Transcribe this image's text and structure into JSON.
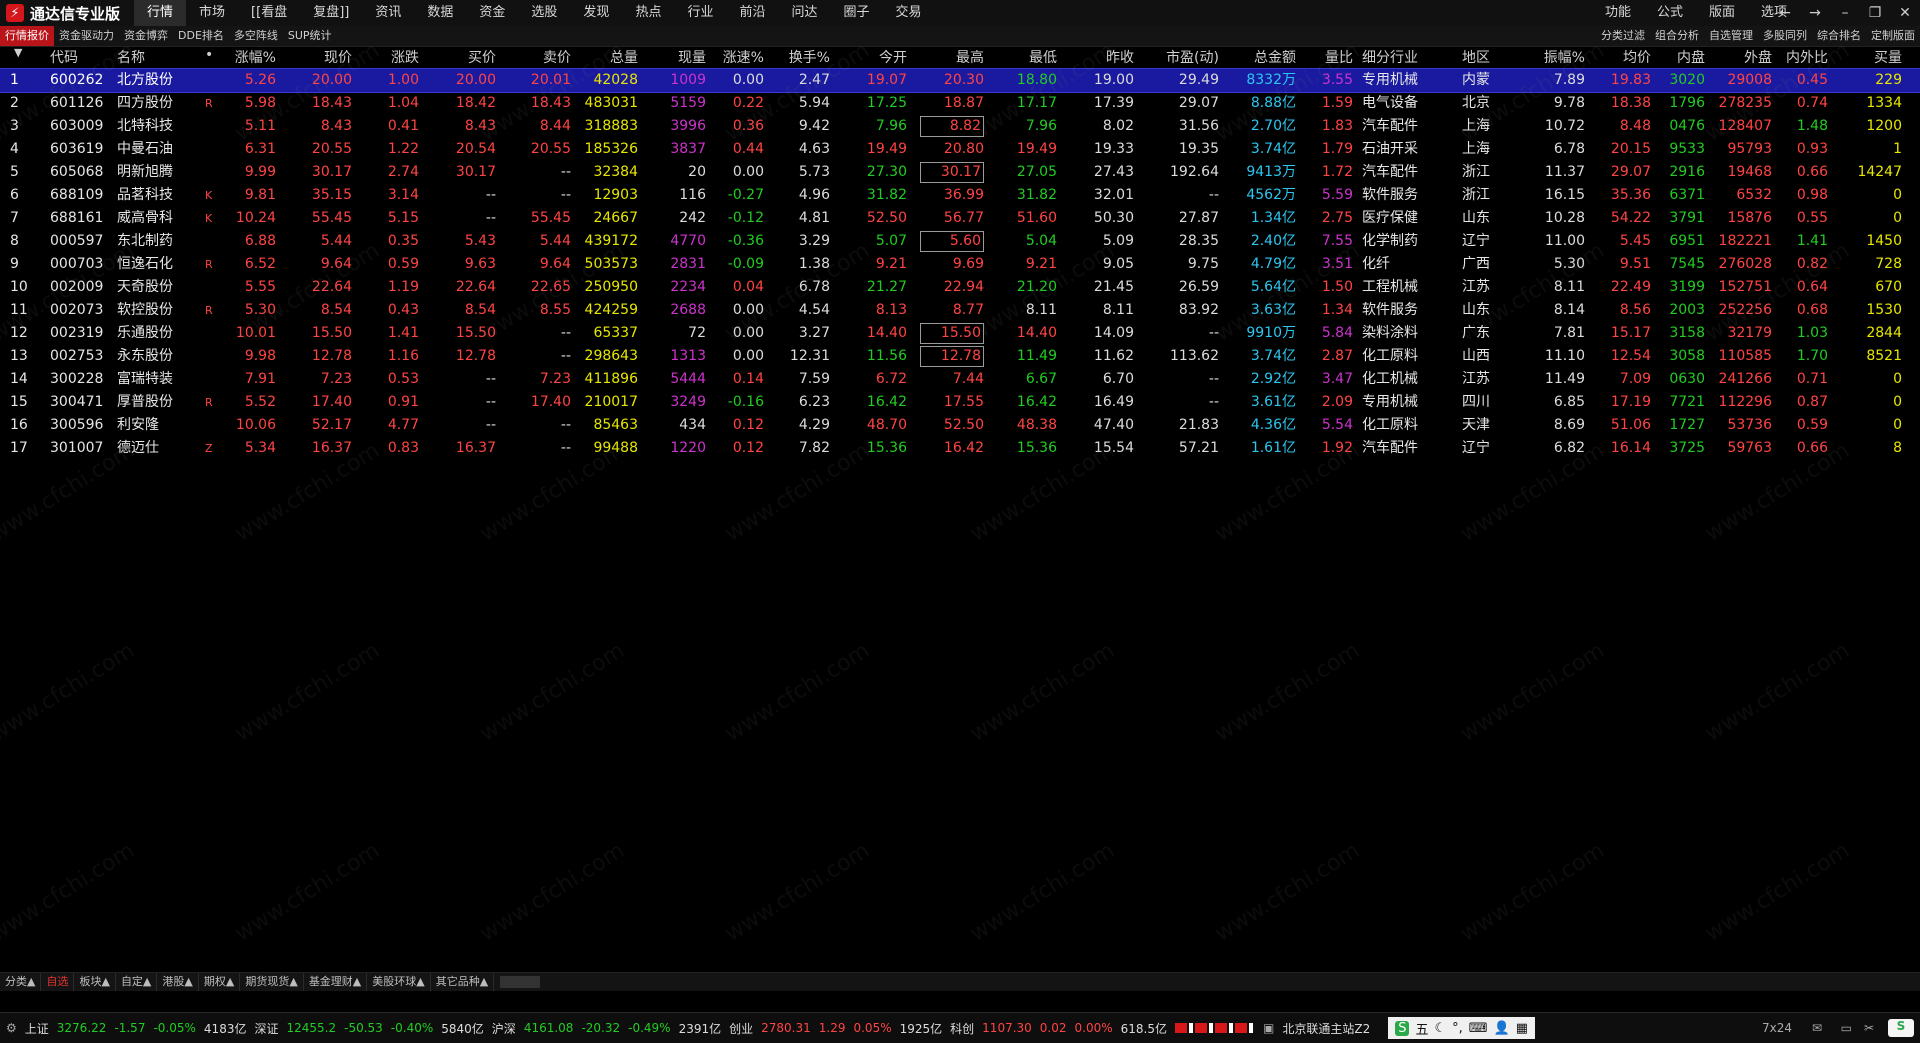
{
  "app": {
    "title": "通达信专业版"
  },
  "menu": [
    "行情",
    "市场",
    "[[看盘",
    "复盘]]",
    "资讯",
    "数据",
    "资金",
    "选股",
    "发现",
    "热点",
    "行业",
    "前沿",
    "问达",
    "圈子",
    "交易"
  ],
  "right_menu": [
    "功能",
    "公式",
    "版面",
    "选项"
  ],
  "toolbar2": [
    "行情报价",
    "资金驱动力",
    "资金博弈",
    "DDE排名",
    "多空阵线",
    "SUP统计"
  ],
  "toolbar2_right": [
    "分类过滤",
    "组合分析",
    "自选管理",
    "多股同列",
    "综合排名",
    "定制版面"
  ],
  "columns": [
    "代码",
    "名称",
    "•",
    "涨幅%",
    "现价",
    "涨跌",
    "买价",
    "卖价",
    "总量",
    "现量",
    "涨速%",
    "换手%",
    "今开",
    "最高",
    "最低",
    "昨收",
    "市盈(动)",
    "总金额",
    "量比",
    "细分行业",
    "地区",
    "振幅%",
    "均价",
    "内盘",
    "外盘",
    "内外比",
    "买量"
  ],
  "rows": [
    {
      "n": "1",
      "code": "600262",
      "name": "北方股份",
      "flag": "",
      "chg_pct": "5.26",
      "price": "20.00",
      "chg": "1.00",
      "bid": "20.00",
      "ask": "20.01",
      "vol": "42028",
      "cur_vol": "1009",
      "speed": "0.00",
      "turnover": "2.47",
      "open": "19.07",
      "high": "20.30",
      "low": "18.80",
      "prev": "19.00",
      "pe": "29.49",
      "amount": "8332万",
      "vol_ratio": "3.55",
      "industry": "专用机械",
      "region": "内蒙",
      "amplitude": "7.89",
      "avg": "19.83",
      "inner": "3020",
      "outer": "29008",
      "io_ratio": "0.45",
      "bid_vol": "229",
      "high_boxed": false
    },
    {
      "n": "2",
      "code": "601126",
      "name": "四方股份",
      "flag": "R",
      "chg_pct": "5.98",
      "price": "18.43",
      "chg": "1.04",
      "bid": "18.42",
      "ask": "18.43",
      "vol": "483031",
      "cur_vol": "5159",
      "speed": "0.22",
      "turnover": "5.94",
      "open": "17.25",
      "high": "18.87",
      "low": "17.17",
      "prev": "17.39",
      "pe": "29.07",
      "amount": "8.88亿",
      "vol_ratio": "1.59",
      "industry": "电气设备",
      "region": "北京",
      "amplitude": "9.78",
      "avg": "18.38",
      "inner": "1796",
      "outer": "278235",
      "io_ratio": "0.74",
      "bid_vol": "1334",
      "high_boxed": false
    },
    {
      "n": "3",
      "code": "603009",
      "name": "北特科技",
      "flag": "",
      "chg_pct": "5.11",
      "price": "8.43",
      "chg": "0.41",
      "bid": "8.43",
      "ask": "8.44",
      "vol": "318883",
      "cur_vol": "3996",
      "speed": "0.36",
      "turnover": "9.42",
      "open": "7.96",
      "high": "8.82",
      "low": "7.96",
      "prev": "8.02",
      "pe": "31.56",
      "amount": "2.70亿",
      "vol_ratio": "1.83",
      "industry": "汽车配件",
      "region": "上海",
      "amplitude": "10.72",
      "avg": "8.48",
      "inner": "0476",
      "outer": "128407",
      "io_ratio": "1.48",
      "bid_vol": "1200",
      "high_boxed": true
    },
    {
      "n": "4",
      "code": "603619",
      "name": "中曼石油",
      "flag": "",
      "chg_pct": "6.31",
      "price": "20.55",
      "chg": "1.22",
      "bid": "20.54",
      "ask": "20.55",
      "vol": "185326",
      "cur_vol": "3837",
      "speed": "0.44",
      "turnover": "4.63",
      "open": "19.49",
      "high": "20.80",
      "low": "19.49",
      "prev": "19.33",
      "pe": "19.35",
      "amount": "3.74亿",
      "vol_ratio": "1.79",
      "industry": "石油开采",
      "region": "上海",
      "amplitude": "6.78",
      "avg": "20.15",
      "inner": "9533",
      "outer": "95793",
      "io_ratio": "0.93",
      "bid_vol": "1",
      "high_boxed": false
    },
    {
      "n": "5",
      "code": "605068",
      "name": "明新旭腾",
      "flag": "",
      "chg_pct": "9.99",
      "price": "30.17",
      "chg": "2.74",
      "bid": "30.17",
      "ask": "--",
      "vol": "32384",
      "cur_vol": "20",
      "speed": "0.00",
      "turnover": "5.73",
      "open": "27.30",
      "high": "30.17",
      "low": "27.05",
      "prev": "27.43",
      "pe": "192.64",
      "amount": "9413万",
      "vol_ratio": "1.72",
      "industry": "汽车配件",
      "region": "浙江",
      "amplitude": "11.37",
      "avg": "29.07",
      "inner": "2916",
      "outer": "19468",
      "io_ratio": "0.66",
      "bid_vol": "14247",
      "high_boxed": true
    },
    {
      "n": "6",
      "code": "688109",
      "name": "品茗科技",
      "flag": "K",
      "chg_pct": "9.81",
      "price": "35.15",
      "chg": "3.14",
      "bid": "--",
      "ask": "--",
      "vol": "12903",
      "cur_vol": "116",
      "speed": "-0.27",
      "turnover": "4.96",
      "open": "31.82",
      "high": "36.99",
      "low": "31.82",
      "prev": "32.01",
      "pe": "--",
      "amount": "4562万",
      "vol_ratio": "5.59",
      "industry": "软件服务",
      "region": "浙江",
      "amplitude": "16.15",
      "avg": "35.36",
      "inner": "6371",
      "outer": "6532",
      "io_ratio": "0.98",
      "bid_vol": "0",
      "high_boxed": false
    },
    {
      "n": "7",
      "code": "688161",
      "name": "威高骨科",
      "flag": "K",
      "chg_pct": "10.24",
      "price": "55.45",
      "chg": "5.15",
      "bid": "--",
      "ask": "55.45",
      "vol": "24667",
      "cur_vol": "242",
      "speed": "-0.12",
      "turnover": "4.81",
      "open": "52.50",
      "high": "56.77",
      "low": "51.60",
      "prev": "50.30",
      "pe": "27.87",
      "amount": "1.34亿",
      "vol_ratio": "2.75",
      "industry": "医疗保健",
      "region": "山东",
      "amplitude": "10.28",
      "avg": "54.22",
      "inner": "3791",
      "outer": "15876",
      "io_ratio": "0.55",
      "bid_vol": "0",
      "high_boxed": false
    },
    {
      "n": "8",
      "code": "000597",
      "name": "东北制药",
      "flag": "",
      "chg_pct": "6.88",
      "price": "5.44",
      "chg": "0.35",
      "bid": "5.43",
      "ask": "5.44",
      "vol": "439172",
      "cur_vol": "4770",
      "speed": "-0.36",
      "turnover": "3.29",
      "open": "5.07",
      "high": "5.60",
      "low": "5.04",
      "prev": "5.09",
      "pe": "28.35",
      "amount": "2.40亿",
      "vol_ratio": "7.55",
      "industry": "化学制药",
      "region": "辽宁",
      "amplitude": "11.00",
      "avg": "5.45",
      "inner": "6951",
      "outer": "182221",
      "io_ratio": "1.41",
      "bid_vol": "1450",
      "high_boxed": true
    },
    {
      "n": "9",
      "code": "000703",
      "name": "恒逸石化",
      "flag": "R",
      "chg_pct": "6.52",
      "price": "9.64",
      "chg": "0.59",
      "bid": "9.63",
      "ask": "9.64",
      "vol": "503573",
      "cur_vol": "2831",
      "speed": "-0.09",
      "turnover": "1.38",
      "open": "9.21",
      "high": "9.69",
      "low": "9.21",
      "prev": "9.05",
      "pe": "9.75",
      "amount": "4.79亿",
      "vol_ratio": "3.51",
      "industry": "化纤",
      "region": "广西",
      "amplitude": "5.30",
      "avg": "9.51",
      "inner": "7545",
      "outer": "276028",
      "io_ratio": "0.82",
      "bid_vol": "728",
      "high_boxed": false
    },
    {
      "n": "10",
      "code": "002009",
      "name": "天奇股份",
      "flag": "",
      "chg_pct": "5.55",
      "price": "22.64",
      "chg": "1.19",
      "bid": "22.64",
      "ask": "22.65",
      "vol": "250950",
      "cur_vol": "2234",
      "speed": "0.04",
      "turnover": "6.78",
      "open": "21.27",
      "high": "22.94",
      "low": "21.20",
      "prev": "21.45",
      "pe": "26.59",
      "amount": "5.64亿",
      "vol_ratio": "1.50",
      "industry": "工程机械",
      "region": "江苏",
      "amplitude": "8.11",
      "avg": "22.49",
      "inner": "3199",
      "outer": "152751",
      "io_ratio": "0.64",
      "bid_vol": "670",
      "high_boxed": false
    },
    {
      "n": "11",
      "code": "002073",
      "name": "软控股份",
      "flag": "R",
      "chg_pct": "5.30",
      "price": "8.54",
      "chg": "0.43",
      "bid": "8.54",
      "ask": "8.55",
      "vol": "424259",
      "cur_vol": "2688",
      "speed": "0.00",
      "turnover": "4.54",
      "open": "8.13",
      "high": "8.77",
      "low": "8.11",
      "prev": "8.11",
      "pe": "83.92",
      "amount": "3.63亿",
      "vol_ratio": "1.34",
      "industry": "软件服务",
      "region": "山东",
      "amplitude": "8.14",
      "avg": "8.56",
      "inner": "2003",
      "outer": "252256",
      "io_ratio": "0.68",
      "bid_vol": "1530",
      "high_boxed": false
    },
    {
      "n": "12",
      "code": "002319",
      "name": "乐通股份",
      "flag": "",
      "chg_pct": "10.01",
      "price": "15.50",
      "chg": "1.41",
      "bid": "15.50",
      "ask": "--",
      "vol": "65337",
      "cur_vol": "72",
      "speed": "0.00",
      "turnover": "3.27",
      "open": "14.40",
      "high": "15.50",
      "low": "14.40",
      "prev": "14.09",
      "pe": "--",
      "amount": "9910万",
      "vol_ratio": "5.84",
      "industry": "染料涂料",
      "region": "广东",
      "amplitude": "7.81",
      "avg": "15.17",
      "inner": "3158",
      "outer": "32179",
      "io_ratio": "1.03",
      "bid_vol": "2844",
      "high_boxed": true
    },
    {
      "n": "13",
      "code": "002753",
      "name": "永东股份",
      "flag": "",
      "chg_pct": "9.98",
      "price": "12.78",
      "chg": "1.16",
      "bid": "12.78",
      "ask": "--",
      "vol": "298643",
      "cur_vol": "1313",
      "speed": "0.00",
      "turnover": "12.31",
      "open": "11.56",
      "high": "12.78",
      "low": "11.49",
      "prev": "11.62",
      "pe": "113.62",
      "amount": "3.74亿",
      "vol_ratio": "2.87",
      "industry": "化工原料",
      "region": "山西",
      "amplitude": "11.10",
      "avg": "12.54",
      "inner": "3058",
      "outer": "110585",
      "io_ratio": "1.70",
      "bid_vol": "8521",
      "high_boxed": true
    },
    {
      "n": "14",
      "code": "300228",
      "name": "富瑞特装",
      "flag": "",
      "chg_pct": "7.91",
      "price": "7.23",
      "chg": "0.53",
      "bid": "--",
      "ask": "7.23",
      "vol": "411896",
      "cur_vol": "5444",
      "speed": "0.14",
      "turnover": "7.59",
      "open": "6.72",
      "high": "7.44",
      "low": "6.67",
      "prev": "6.70",
      "pe": "--",
      "amount": "2.92亿",
      "vol_ratio": "3.47",
      "industry": "化工机械",
      "region": "江苏",
      "amplitude": "11.49",
      "avg": "7.09",
      "inner": "0630",
      "outer": "241266",
      "io_ratio": "0.71",
      "bid_vol": "0",
      "high_boxed": false
    },
    {
      "n": "15",
      "code": "300471",
      "name": "厚普股份",
      "flag": "R",
      "chg_pct": "5.52",
      "price": "17.40",
      "chg": "0.91",
      "bid": "--",
      "ask": "17.40",
      "vol": "210017",
      "cur_vol": "3249",
      "speed": "-0.16",
      "turnover": "6.23",
      "open": "16.42",
      "high": "17.55",
      "low": "16.42",
      "prev": "16.49",
      "pe": "--",
      "amount": "3.61亿",
      "vol_ratio": "2.09",
      "industry": "专用机械",
      "region": "四川",
      "amplitude": "6.85",
      "avg": "17.19",
      "inner": "7721",
      "outer": "112296",
      "io_ratio": "0.87",
      "bid_vol": "0",
      "high_boxed": false
    },
    {
      "n": "16",
      "code": "300596",
      "name": "利安隆",
      "flag": "",
      "chg_pct": "10.06",
      "price": "52.17",
      "chg": "4.77",
      "bid": "--",
      "ask": "--",
      "vol": "85463",
      "cur_vol": "434",
      "speed": "0.12",
      "turnover": "4.29",
      "open": "48.70",
      "high": "52.50",
      "low": "48.38",
      "prev": "47.40",
      "pe": "21.83",
      "amount": "4.36亿",
      "vol_ratio": "5.54",
      "industry": "化工原料",
      "region": "天津",
      "amplitude": "8.69",
      "avg": "51.06",
      "inner": "1727",
      "outer": "53736",
      "io_ratio": "0.59",
      "bid_vol": "0",
      "high_boxed": false
    },
    {
      "n": "17",
      "code": "301007",
      "name": "德迈仕",
      "flag": "Z",
      "chg_pct": "5.34",
      "price": "16.37",
      "chg": "0.83",
      "bid": "16.37",
      "ask": "--",
      "vol": "99488",
      "cur_vol": "1220",
      "speed": "0.12",
      "turnover": "7.82",
      "open": "15.36",
      "high": "16.42",
      "low": "15.36",
      "prev": "15.54",
      "pe": "57.21",
      "amount": "1.61亿",
      "vol_ratio": "1.92",
      "industry": "汽车配件",
      "region": "辽宁",
      "amplitude": "6.82",
      "avg": "16.14",
      "inner": "3725",
      "outer": "59763",
      "io_ratio": "0.66",
      "bid_vol": "8",
      "high_boxed": false
    }
  ],
  "bottom_tabs": [
    "分类▲",
    "自选",
    "板块▲",
    "自定▲",
    "港股▲",
    "期权▲",
    "期货现货▲",
    "基金理财▲",
    "美股环球▲",
    "其它品种▲"
  ],
  "status": {
    "sh_label": "上证",
    "sh_val": "3276.22",
    "sh_chg": "-1.57",
    "sh_pct": "-0.05%",
    "sh_amt": "4183亿",
    "sz_label": "深证",
    "sz_val": "12455.2",
    "sz_chg": "-50.53",
    "sz_pct": "-0.40%",
    "sz_amt": "5840亿",
    "hs_label": "沪深",
    "hs_val": "4161.08",
    "hs_chg": "-20.32",
    "hs_pct": "-0.49%",
    "hs_amt": "2391亿",
    "cy_label": "创业",
    "cy_val": "2780.31",
    "cy_chg": "1.29",
    "cy_pct": "0.05%",
    "cy_amt": "1925亿",
    "kc_label": "科创",
    "kc_val": "1107.30",
    "kc_chg": "0.02",
    "kc_pct": "0.00%",
    "kc_amt": "618.5亿",
    "server": "北京联通主站Z2",
    "ime_char": "五",
    "clock": "7x24"
  },
  "watermark": "www.cfchi.com",
  "colors": {
    "up": "#ff4444",
    "down": "#22cc22",
    "flat": "#dcdcdc",
    "volume": "#e6e600",
    "amount": "#2cc7f0",
    "current_vol": "#cc33cc",
    "selected_row": "#1a1aa0"
  }
}
